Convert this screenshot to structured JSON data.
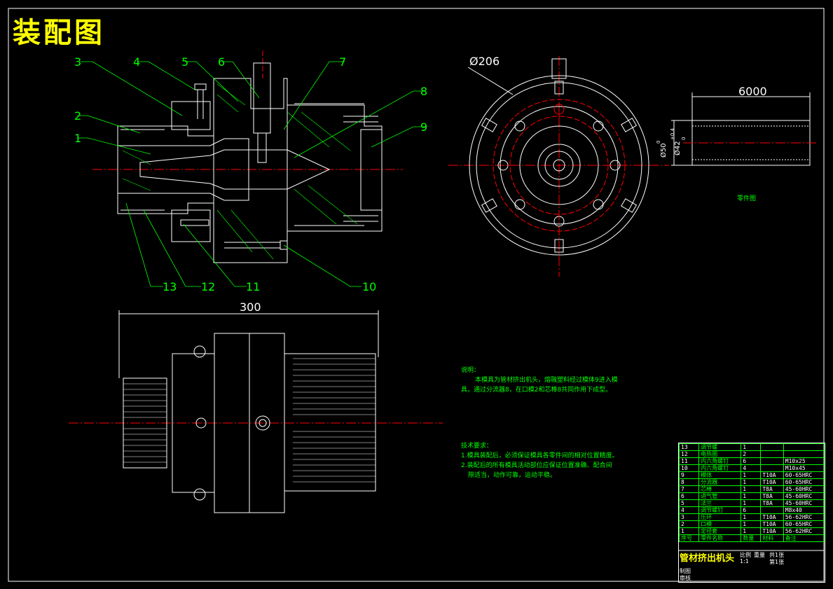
{
  "title": "装配图",
  "part_labels": [
    "1",
    "2",
    "3",
    "4",
    "5",
    "6",
    "7",
    "8",
    "9",
    "10",
    "11",
    "12",
    "13"
  ],
  "dims": {
    "diameter": "Ø206",
    "length_top": "6000",
    "length_bottom": "300",
    "tube_d1": "Ø50",
    "tube_d1_tol": "0",
    "tube_d2": "Ø42",
    "tube_d2_tol_hi": "+0.4",
    "tube_d2_tol_lo": "0"
  },
  "part_drawing_caption": "零件图",
  "notes": {
    "header": "说明：",
    "body1": "本模具为管材挤出机头，熔融塑料经过模体9进入模",
    "body2": "具，通过分流器8，在口模2和芯棒8共同作用下成型。",
    "tech_header": "技术要求：",
    "tech1": "1.模具装配后，必须保证模具各零件间的相对位置精度。",
    "tech2": "2.装配后的所有模具活动部位应保证位置准确、配合间",
    "tech3": "隙适当，动作可靠，运动平稳。"
  },
  "bom": [
    {
      "no": "13",
      "name": "调节螺",
      "qty": "1",
      "mat": "",
      "spec": ""
    },
    {
      "no": "12",
      "name": "电热圈",
      "qty": "2",
      "mat": "",
      "spec": ""
    },
    {
      "no": "11",
      "name": "内六角螺钉",
      "qty": "6",
      "mat": "",
      "spec": "M10x25"
    },
    {
      "no": "10",
      "name": "内六角螺钉",
      "qty": "4",
      "mat": "",
      "spec": "M10x45"
    },
    {
      "no": "9",
      "name": "模体",
      "qty": "1",
      "mat": "T10A",
      "spec": "60-65HRC"
    },
    {
      "no": "8",
      "name": "分流器",
      "qty": "1",
      "mat": "T10A",
      "spec": "60-65HRC"
    },
    {
      "no": "7",
      "name": "芯棒",
      "qty": "1",
      "mat": "T8A",
      "spec": "45-60HRC"
    },
    {
      "no": "6",
      "name": "进气管",
      "qty": "1",
      "mat": "T8A",
      "spec": "45-60HRC"
    },
    {
      "no": "5",
      "name": "法兰",
      "qty": "1",
      "mat": "T8A",
      "spec": "45-60HRC"
    },
    {
      "no": "4",
      "name": "调节螺钉",
      "qty": "6",
      "mat": "",
      "spec": "M8x40"
    },
    {
      "no": "3",
      "name": "压环",
      "qty": "1",
      "mat": "T10A",
      "spec": "56-62HRC"
    },
    {
      "no": "2",
      "name": "口模",
      "qty": "1",
      "mat": "T10A",
      "spec": "60-65HRC"
    },
    {
      "no": "1",
      "name": "定径套",
      "qty": "1",
      "mat": "T10A",
      "spec": "56-62HRC"
    }
  ],
  "bom_header": {
    "no": "序号",
    "name": "零件名称",
    "qty": "数量",
    "mat": "材料",
    "spec": "备注"
  },
  "title_block": {
    "name": "管材挤出机头",
    "scale": "1:1",
    "c1": "比例",
    "c2": "重量",
    "c3": "共1张",
    "c4": "第1张",
    "r1": "制图",
    "r2": "审核"
  },
  "colors": {
    "line_white": "#ffffff",
    "label_green": "#00ff00",
    "title_yellow": "#ffff00",
    "center_red": "#ff0000",
    "frame": "#ffffff"
  }
}
